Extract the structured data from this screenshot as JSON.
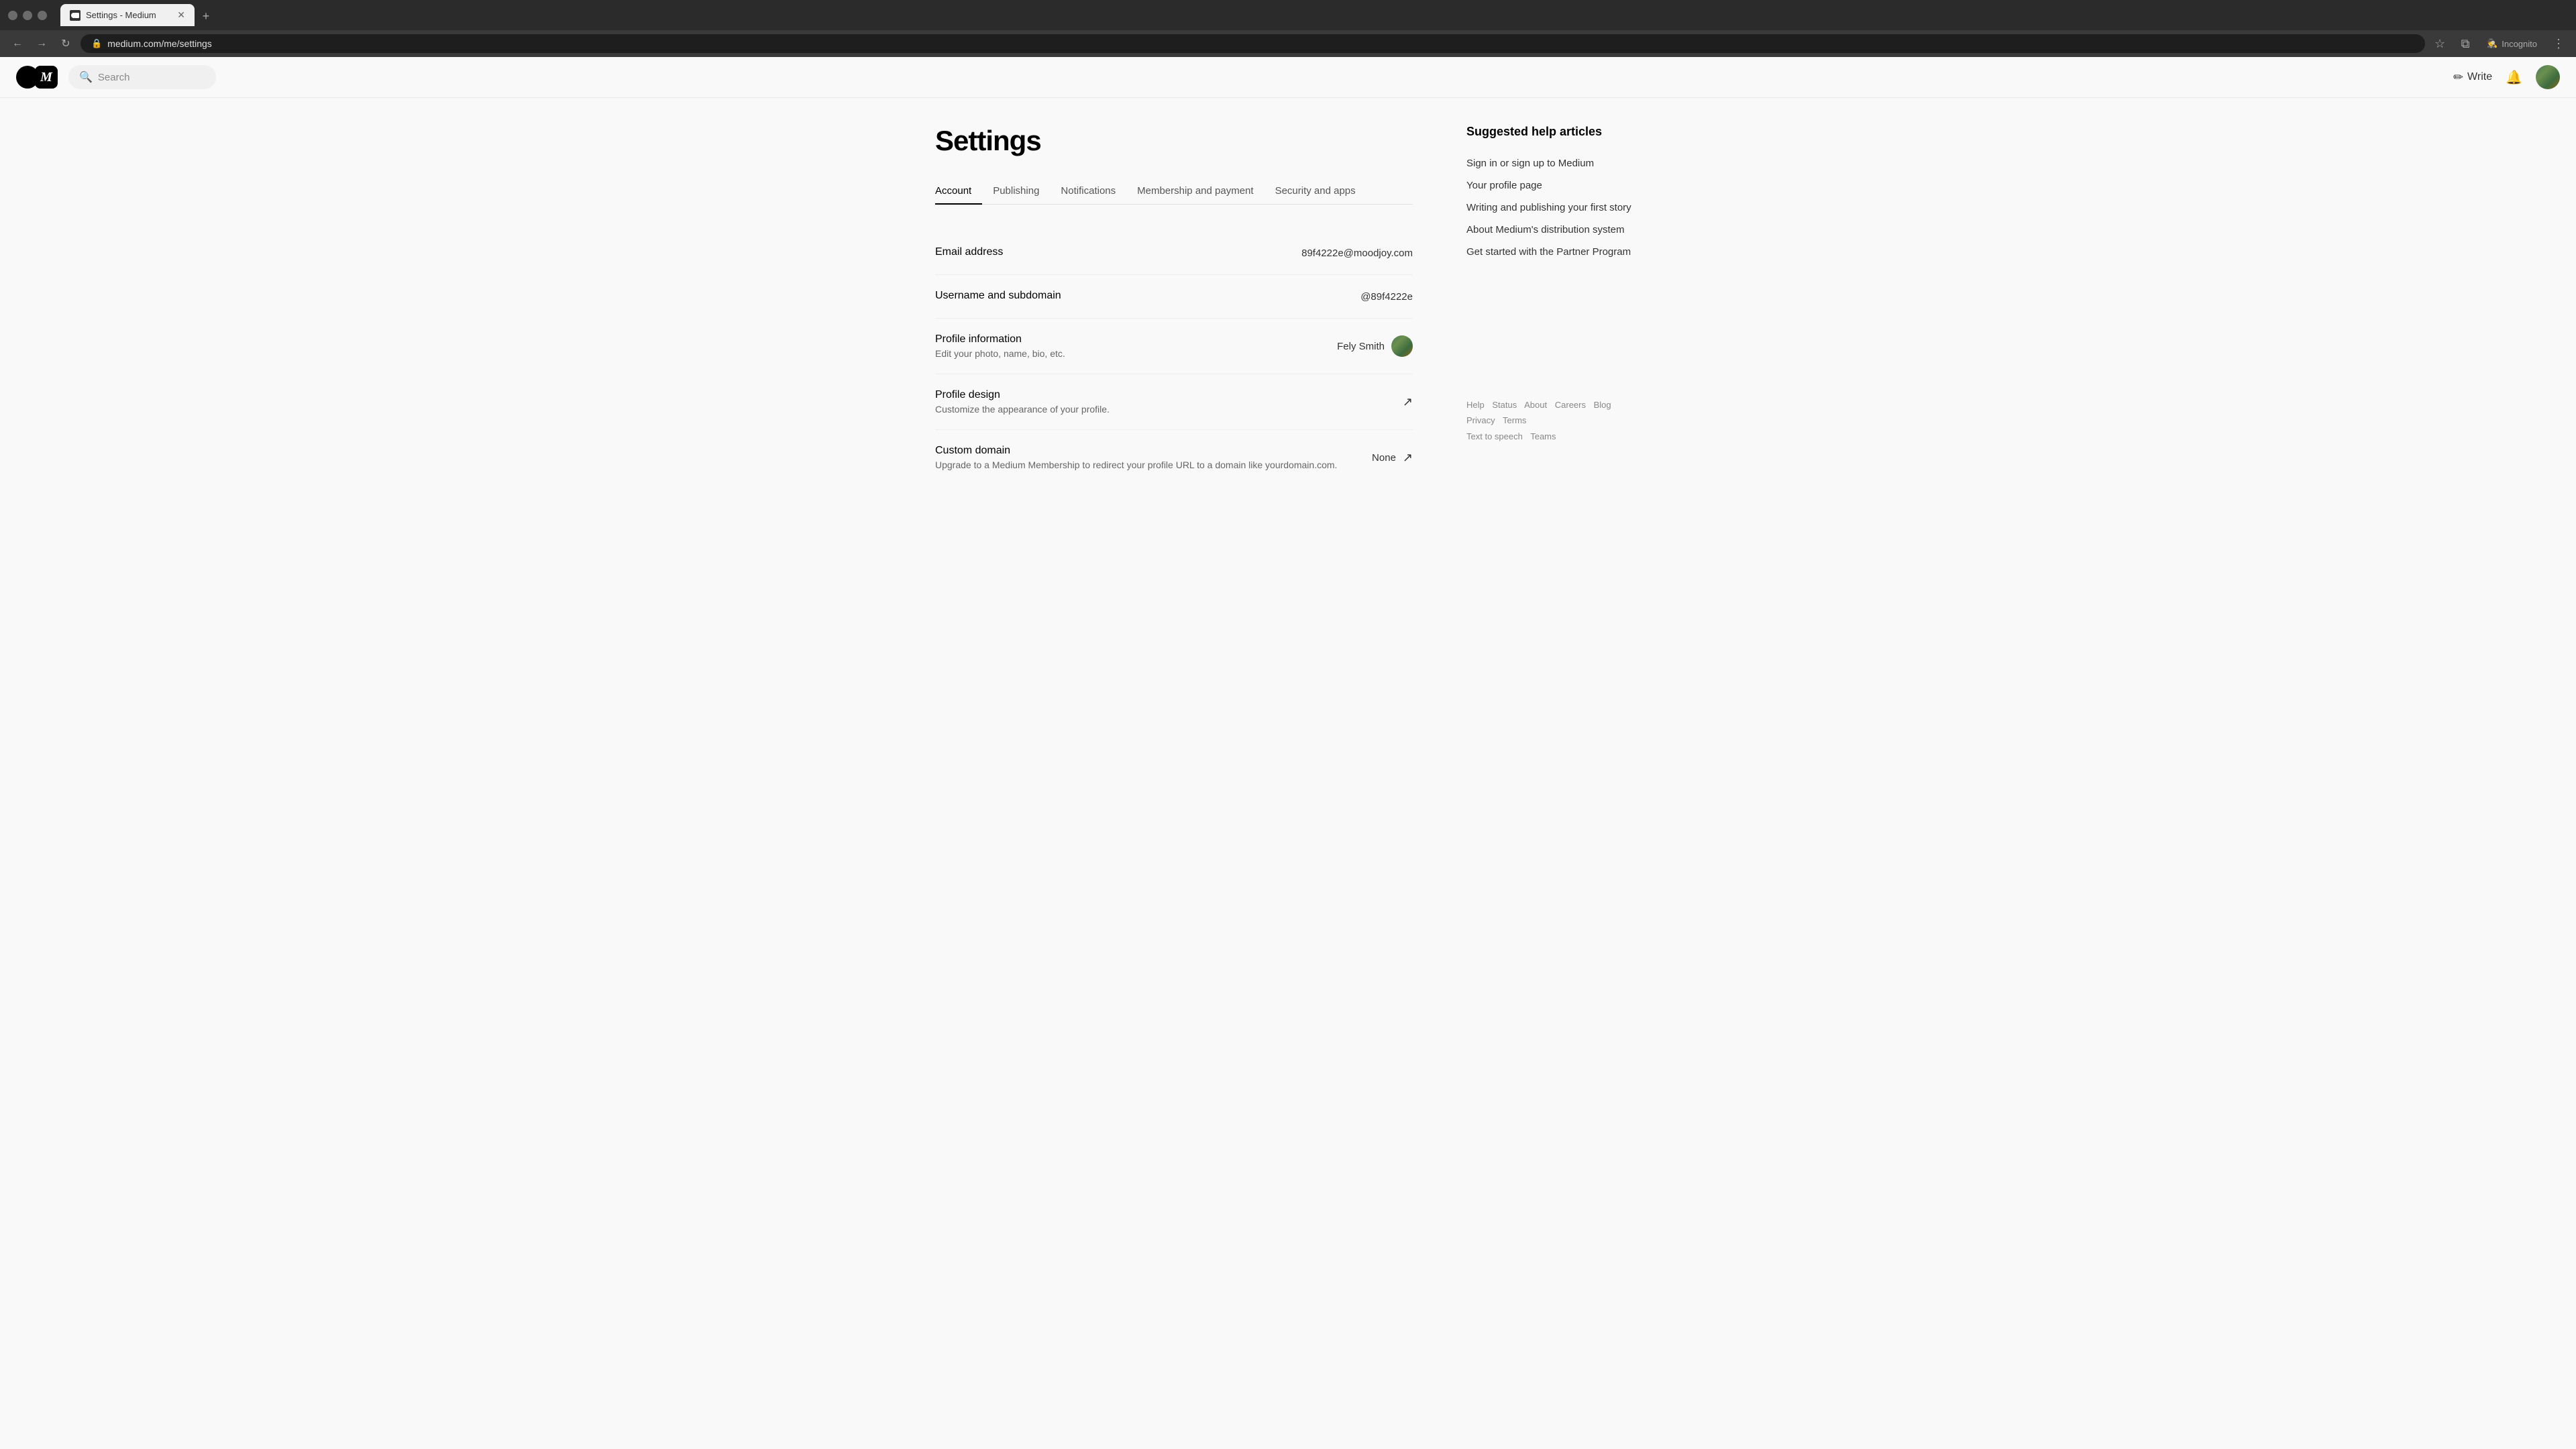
{
  "browser": {
    "tab_title": "Settings - Medium",
    "tab_favicon": "M",
    "url": "medium.com/me/settings",
    "nav": {
      "back": "←",
      "forward": "→",
      "reload": "↻"
    },
    "toolbar": {
      "bookmark": "☆",
      "sidebar": "⧉",
      "incognito_label": "Incognito",
      "more": "⋮"
    },
    "new_tab": "+"
  },
  "header": {
    "search_placeholder": "Search",
    "write_label": "Write",
    "write_icon": "✏"
  },
  "page": {
    "title": "Settings",
    "tabs": [
      {
        "id": "account",
        "label": "Account",
        "active": true
      },
      {
        "id": "publishing",
        "label": "Publishing"
      },
      {
        "id": "notifications",
        "label": "Notifications"
      },
      {
        "id": "membership",
        "label": "Membership and payment"
      },
      {
        "id": "security",
        "label": "Security and apps"
      }
    ]
  },
  "settings_rows": [
    {
      "id": "email",
      "label": "Email address",
      "sublabel": "",
      "value": "89f4222e@moodjoy.com",
      "has_avatar": false,
      "has_external_link": false
    },
    {
      "id": "username",
      "label": "Username and subdomain",
      "sublabel": "",
      "value": "@89f4222e",
      "has_avatar": false,
      "has_external_link": false
    },
    {
      "id": "profile_info",
      "label": "Profile information",
      "sublabel": "Edit your photo, name, bio, etc.",
      "value": "Fely Smith",
      "has_avatar": true,
      "has_external_link": false
    },
    {
      "id": "profile_design",
      "label": "Profile design",
      "sublabel": "Customize the appearance of your profile.",
      "value": "",
      "has_avatar": false,
      "has_external_link": true
    },
    {
      "id": "custom_domain",
      "label": "Custom domain",
      "sublabel": "Upgrade to a Medium Membership to redirect your profile URL to a domain like yourdomain.com.",
      "value": "None",
      "has_avatar": false,
      "has_external_link": true
    }
  ],
  "sidebar": {
    "suggested_title": "Suggested help articles",
    "help_links": [
      "Sign in or sign up to Medium",
      "Your profile page",
      "Writing and publishing your first story",
      "About Medium's distribution system",
      "Get started with the Partner Program"
    ],
    "footer_links": [
      "Help",
      "Status",
      "About",
      "Careers",
      "Blog",
      "Privacy",
      "Terms",
      "Text to speech",
      "Teams"
    ]
  }
}
